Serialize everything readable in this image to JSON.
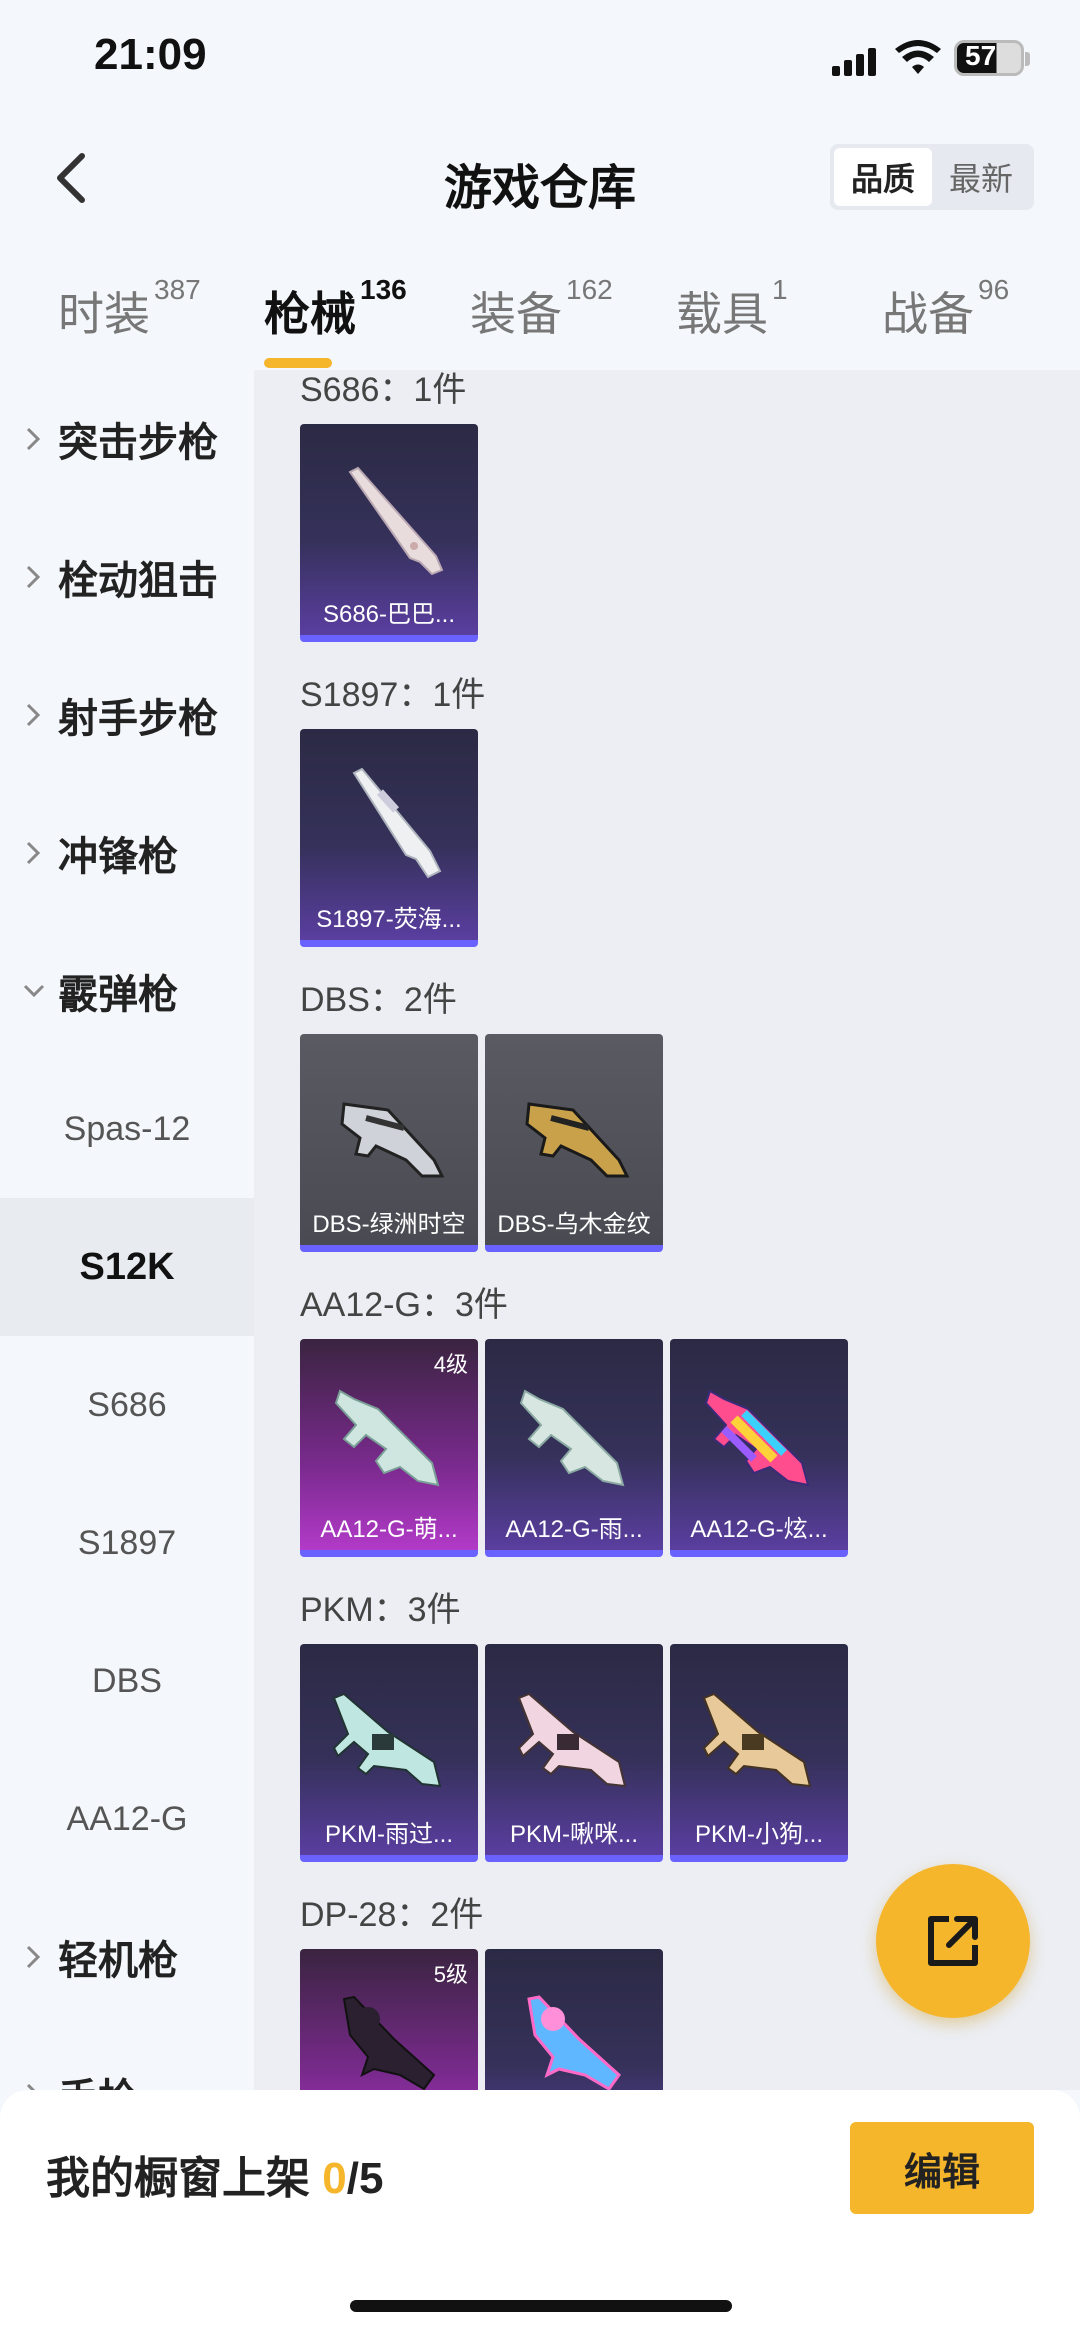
{
  "status_bar": {
    "time": "21:09",
    "battery": "57"
  },
  "header": {
    "title": "游戏仓库",
    "sort_options": [
      "品质",
      "最新"
    ],
    "sort_active": "品质"
  },
  "tabs": [
    {
      "label": "时装",
      "count": "387"
    },
    {
      "label": "枪械",
      "count": "136"
    },
    {
      "label": "装备",
      "count": "162"
    },
    {
      "label": "载具",
      "count": "1"
    },
    {
      "label": "战备",
      "count": "96"
    }
  ],
  "sidebar": {
    "categories": [
      "突击步枪",
      "栓动狙击",
      "射手步枪",
      "冲锋枪",
      "霰弹枪"
    ],
    "subitems": [
      "Spas-12",
      "S12K",
      "S686",
      "S1897",
      "DBS",
      "AA12-G"
    ],
    "more_categories": [
      "轻机枪",
      "手枪"
    ]
  },
  "groups": [
    {
      "title": "S686：1件",
      "items": [
        {
          "name": "S686-巴巴...",
          "level": ""
        }
      ]
    },
    {
      "title": "S1897：1件",
      "items": [
        {
          "name": "S1897-荧海...",
          "level": ""
        }
      ]
    },
    {
      "title": "DBS：2件",
      "items": [
        {
          "name": "DBS-绿洲时空",
          "level": ""
        },
        {
          "name": "DBS-乌木金纹",
          "level": ""
        }
      ]
    },
    {
      "title": "AA12-G：3件",
      "items": [
        {
          "name": "AA12-G-萌...",
          "level": "4级"
        },
        {
          "name": "AA12-G-雨...",
          "level": ""
        },
        {
          "name": "AA12-G-炫...",
          "level": ""
        }
      ]
    },
    {
      "title": "PKM：3件",
      "items": [
        {
          "name": "PKM-雨过...",
          "level": ""
        },
        {
          "name": "PKM-啾咪...",
          "level": ""
        },
        {
          "name": "PKM-小狗...",
          "level": ""
        }
      ]
    },
    {
      "title": "DP-28：2件",
      "items": [
        {
          "name": "",
          "level": "5级"
        },
        {
          "name": "",
          "level": ""
        }
      ]
    }
  ],
  "bottom": {
    "label": "我的橱窗上架 ",
    "count": "0",
    "total": "/5",
    "edit": "编辑"
  },
  "colors": {
    "accent": "#f5b62c",
    "rarity_purple": "#6a62ff"
  },
  "icons": {
    "back": "chevron-left-icon",
    "share": "external-share-icon"
  }
}
